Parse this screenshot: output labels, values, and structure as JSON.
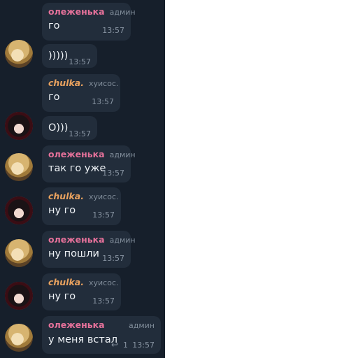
{
  "messages": [
    {
      "author": "олеженька",
      "role": "админ",
      "text": "го",
      "time": "13:57"
    },
    {
      "text": ")))))",
      "time": "13:57"
    },
    {
      "author": "chulka.",
      "role": "хуисос.",
      "text": "го",
      "time": "13:57"
    },
    {
      "text": "О)))",
      "time": "13:57"
    },
    {
      "author": "олеженька",
      "role": "админ",
      "text": "так го уже",
      "time": "13:57"
    },
    {
      "author": "chulka.",
      "role": "хуисос.",
      "text": "ну го",
      "time": "13:57"
    },
    {
      "author": "олеженька",
      "role": "админ",
      "text": "ну пошли",
      "time": "13:57"
    },
    {
      "author": "chulka.",
      "role": "хуисос.",
      "text": "ну го",
      "time": "13:57"
    },
    {
      "author": "олеженька",
      "role": "админ",
      "text": "у меня встал",
      "time": "13:57",
      "reply_count": "1"
    }
  ],
  "icons": {
    "reply": "reply-arrow-icon"
  },
  "colors": {
    "background": "#161f2b",
    "bubble": "#222d3b",
    "name_admin": "#e5719a",
    "name_chulka": "#e9a25f"
  }
}
